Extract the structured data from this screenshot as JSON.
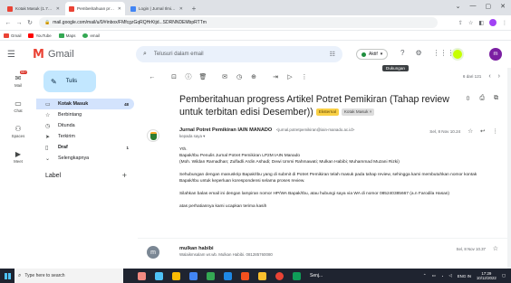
{
  "browser": {
    "tabs": [
      {
        "title": "Kotak Masuk (1.705) - mulkanhabibi",
        "active": false,
        "favicon_color": "#ea4335"
      },
      {
        "title": "Pemberitahuan progress Artikel Potret",
        "active": true,
        "favicon_color": "#ea4335"
      },
      {
        "title": "Login | Jurnal Ilmiah Komunikasi",
        "active": false,
        "favicon_color": "#4285f4"
      }
    ],
    "new_tab": "+",
    "window_controls": [
      "⌄",
      "—",
      "▢",
      "✕"
    ],
    "url": "mail.google.com/mail/u/0/#inbox/FMfcgzGqRQHrKtjd...SDRNNDEMbpRTTm",
    "bookmarks": [
      {
        "label": "Gmail",
        "color": "#ea4335"
      },
      {
        "label": "YouTube",
        "color": "#ff0000"
      },
      {
        "label": "Maps",
        "color": "#34a853"
      },
      {
        "label": "email",
        "color": "#34a853"
      }
    ]
  },
  "gmail": {
    "brand": "Gmail",
    "search_placeholder": "Telusuri dalam email",
    "status": "Aktif",
    "avatar_letter": "m",
    "rail": [
      {
        "label": "Mail",
        "badge": "99+"
      },
      {
        "label": "Chat"
      },
      {
        "label": "Spaces"
      },
      {
        "label": "Meet"
      }
    ],
    "compose": "Tulis",
    "nav": [
      {
        "label": "Kotak Masuk",
        "count": "48",
        "active": true,
        "icon": "inbox-icon"
      },
      {
        "label": "Berbintang",
        "count": "",
        "active": false,
        "icon": "star-icon"
      },
      {
        "label": "Ditunda",
        "count": "",
        "active": false,
        "icon": "clock-icon"
      },
      {
        "label": "Terkirim",
        "count": "",
        "active": false,
        "icon": "send-icon"
      },
      {
        "label": "Draf",
        "count": "1",
        "active": false,
        "icon": "draft-icon"
      },
      {
        "label": "Selengkapnya",
        "count": "",
        "active": false,
        "icon": "chevron-down-icon"
      }
    ],
    "labels_heading": "Label",
    "toolbar": {
      "pager": "6 dari 121",
      "tooltip": "Dukungan"
    },
    "subject": "Pemberitahuan progress Artikel Potret Pemikiran (Tahap review untuk terbitan edisi Desember))",
    "chips": {
      "external": "Eksternal",
      "inbox": "Kotak Masuk ×"
    },
    "message": {
      "sender": "Jurnal Potret Pemikiran IAIN MANADO",
      "sender_email": "<jurnal.potretpemikiran@iain-manado.ac.id>",
      "to": "kepada saya ▾",
      "date": "Sel, 8 Nov 10.24",
      "body": [
        "Yth.\nBapak/Ibu Penulis Jurnal Potret Pemikiran LP2M IAIN Manado\n(Moh. Wildan Ramadhan; Zulfadli Ardin Ashadi; Dewi Ummi Rahmawati; Mulkan Habibi; Muhammad Muzani Rizki)",
        "Sehubungan dengan manuskrip Bapak/Ibu yang di submit di Potret Pemikiran telah masuk pada tahap review, sehingga kami membutuhkan nomor kontak Bapak/Ibu untuk keperluan korespondensi selama proses review.",
        "Silahkan balas email ini dengan lampiran nomor HP/WA Bapak/Ibu, atau hubungi saya via WA di nomor 085240385667 (a.n Farodila Hasan)",
        "atas perhatiannya kami ucapkan terima kasih"
      ]
    },
    "reply": {
      "initial": "m",
      "name": "mulkan habibi",
      "snippet": "Walaikmsalam wr.wb. Mulkan Habibi. 081285760080",
      "date": "Sel, 8 Nov 10.37"
    }
  },
  "taskbar": {
    "search_placeholder": "Type here to search",
    "app_colors": [
      "#f28b82",
      "#4fc3f7",
      "#34a853",
      "#fbbc04",
      "#ea4335",
      "#4285f4",
      "#1e88e5",
      "#f4511e",
      "#fbc02d",
      "#0f9d58"
    ],
    "running_label": "Senj...",
    "language": "ENG IN",
    "time": "17:29",
    "date": "10/12/2022"
  },
  "colors": {
    "accent": "#c2e7ff",
    "active_nav": "#d3e3fd",
    "search_bg": "#eaf1fb",
    "brand_red": "#ea4335"
  }
}
